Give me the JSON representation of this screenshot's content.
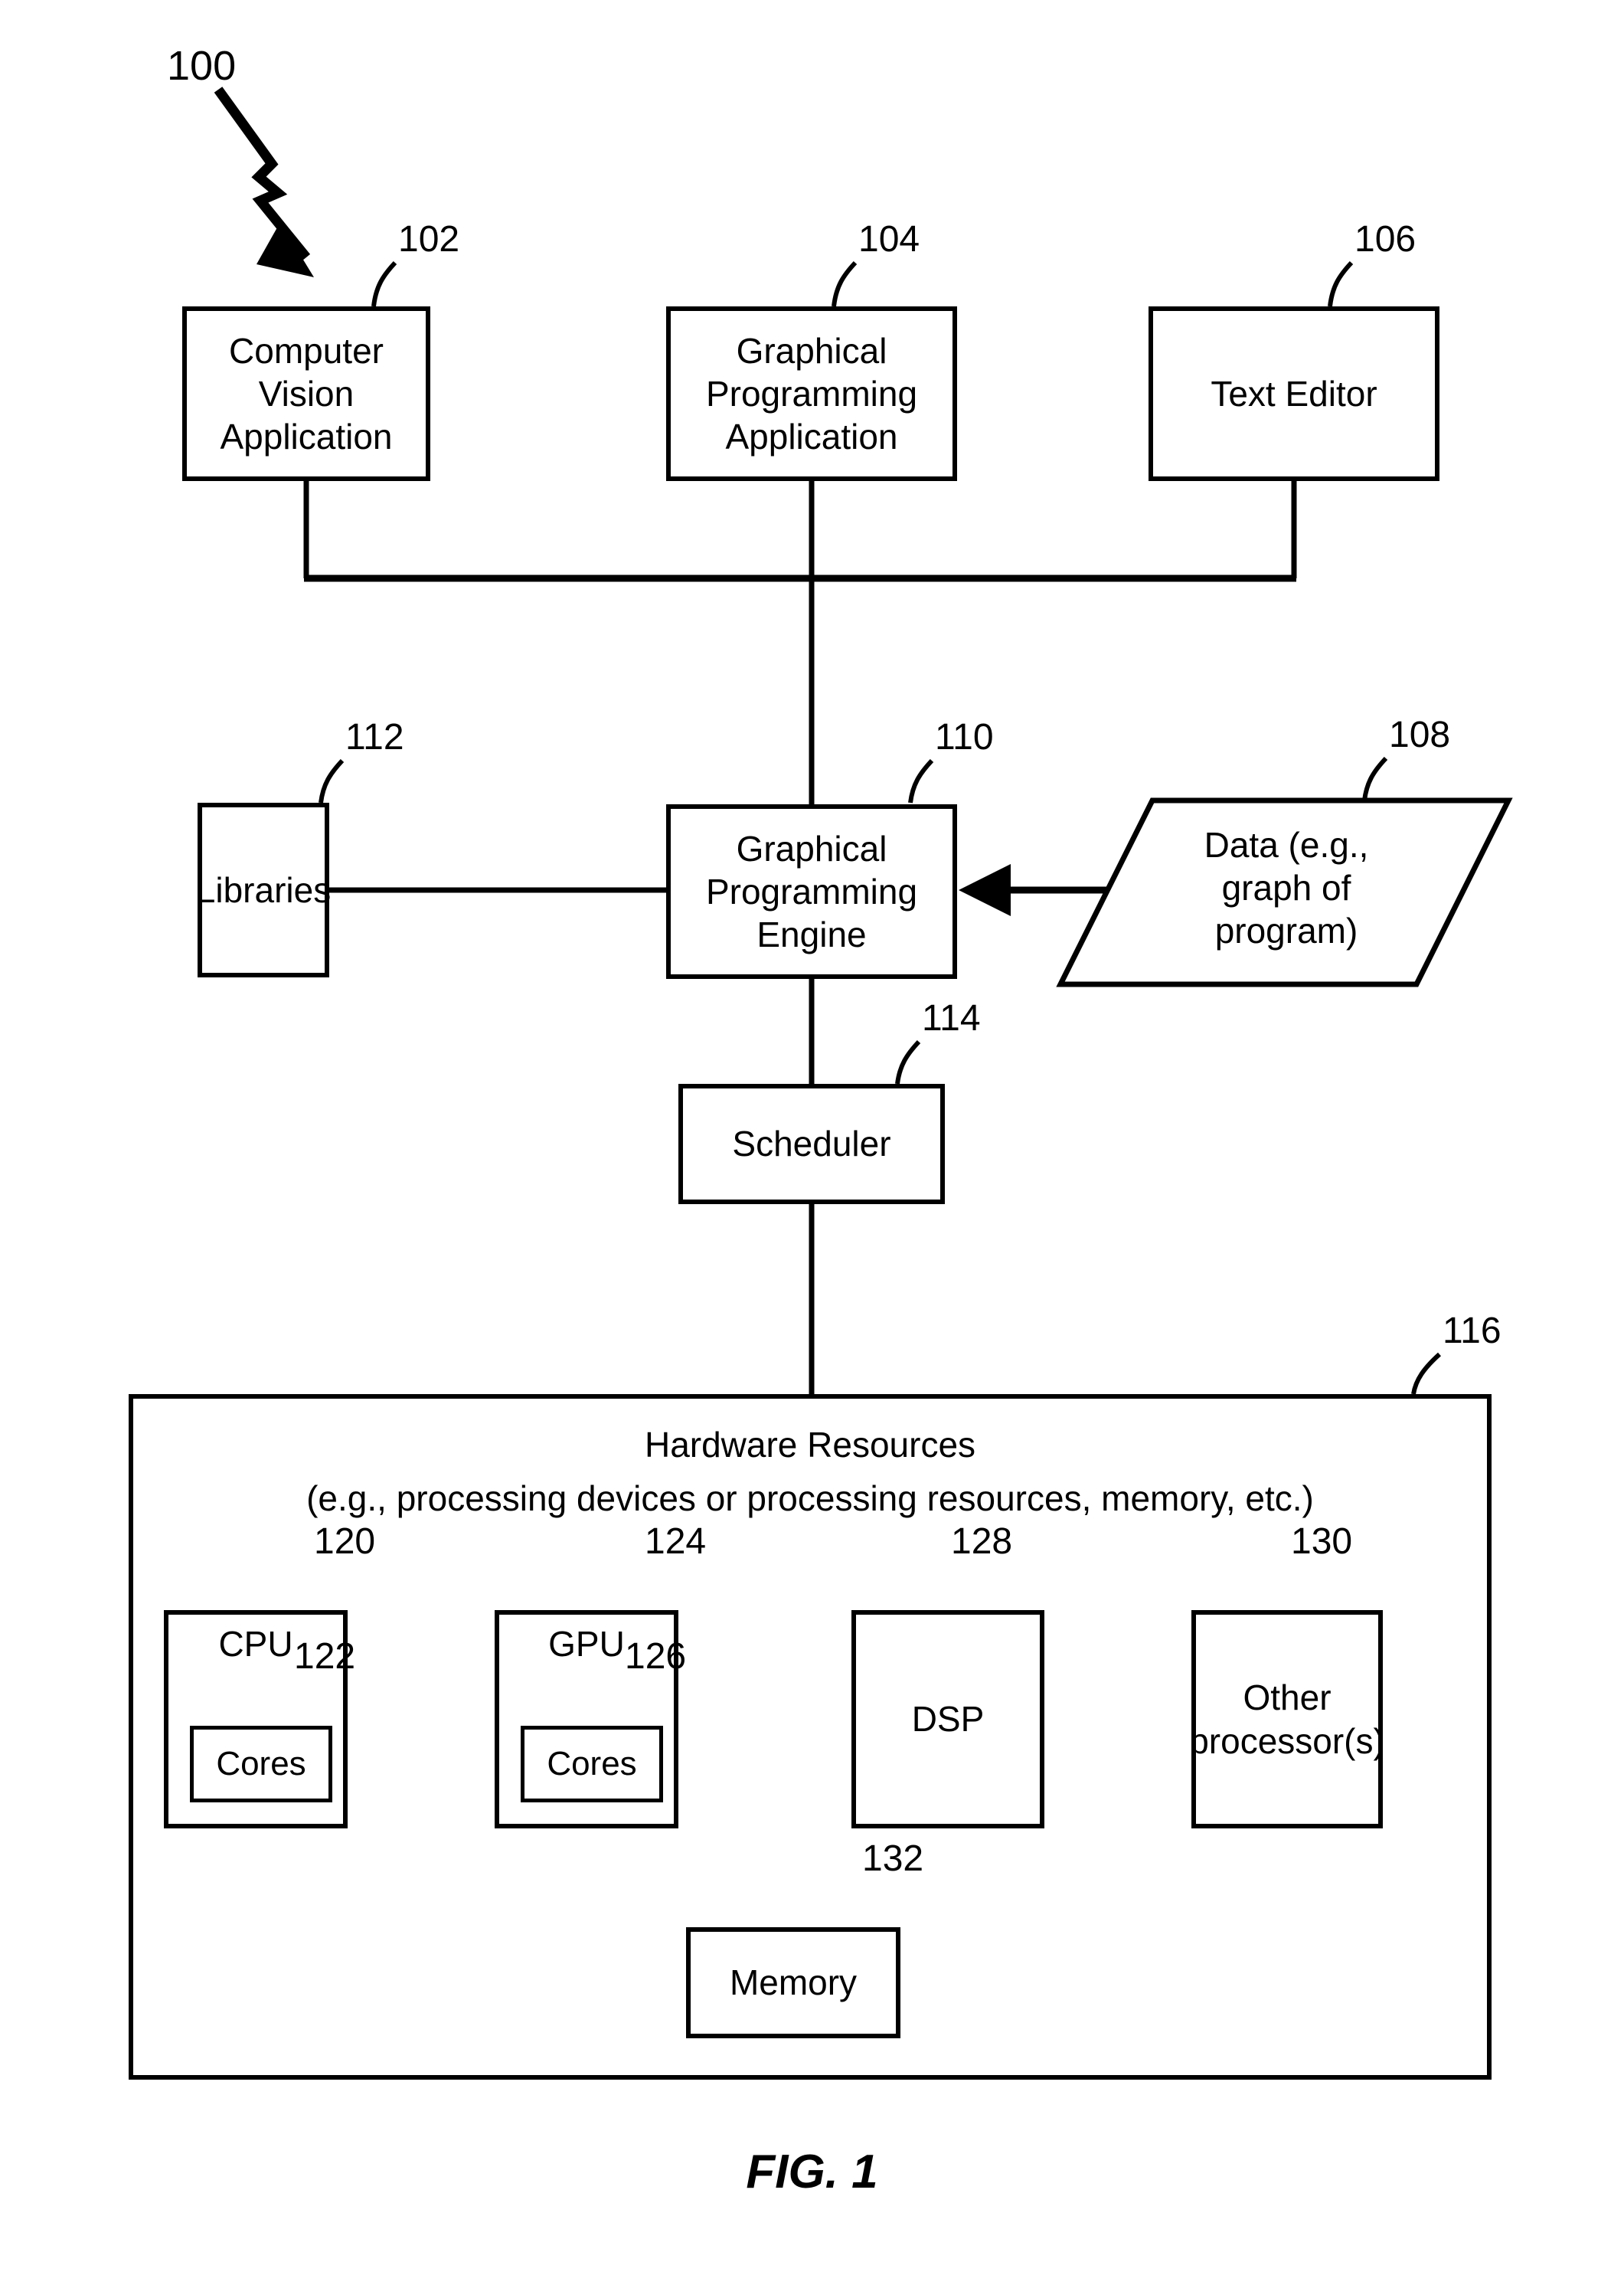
{
  "figure": {
    "caption": "FIG. 1",
    "system_ref": "100"
  },
  "nodes": {
    "computer_vision_application": {
      "ref": "102",
      "label": "Computer\nVision\nApplication",
      "line1": "Computer",
      "line2": "Vision",
      "line3": "Application"
    },
    "graphical_programming_application": {
      "ref": "104",
      "line1": "Graphical",
      "line2": "Programming",
      "line3": "Application"
    },
    "text_editor": {
      "ref": "106",
      "label": "Text Editor"
    },
    "data": {
      "ref": "108",
      "line1": "Data (e.g.,",
      "line2": "graph of",
      "line3": "program)"
    },
    "graphical_programming_engine": {
      "ref": "110",
      "line1": "Graphical",
      "line2": "Programming",
      "line3": "Engine"
    },
    "libraries": {
      "ref": "112",
      "label": "Libraries"
    },
    "scheduler": {
      "ref": "114",
      "label": "Scheduler"
    },
    "hardware_resources": {
      "ref": "116",
      "title": "Hardware Resources",
      "subtitle": "(e.g., processing devices or processing resources, memory, etc.)"
    },
    "cpu": {
      "ref": "120",
      "label": "CPU"
    },
    "cpu_cores": {
      "ref": "122",
      "label": "Cores"
    },
    "gpu": {
      "ref": "124",
      "label": "GPU"
    },
    "gpu_cores": {
      "ref": "126",
      "label": "Cores"
    },
    "dsp": {
      "ref": "128",
      "label": "DSP"
    },
    "other_processors": {
      "ref": "130",
      "line1": "Other",
      "line2": "processor(s)"
    },
    "memory": {
      "ref": "132",
      "label": "Memory"
    }
  },
  "colors": {
    "stroke": "#000000",
    "background": "#ffffff"
  }
}
